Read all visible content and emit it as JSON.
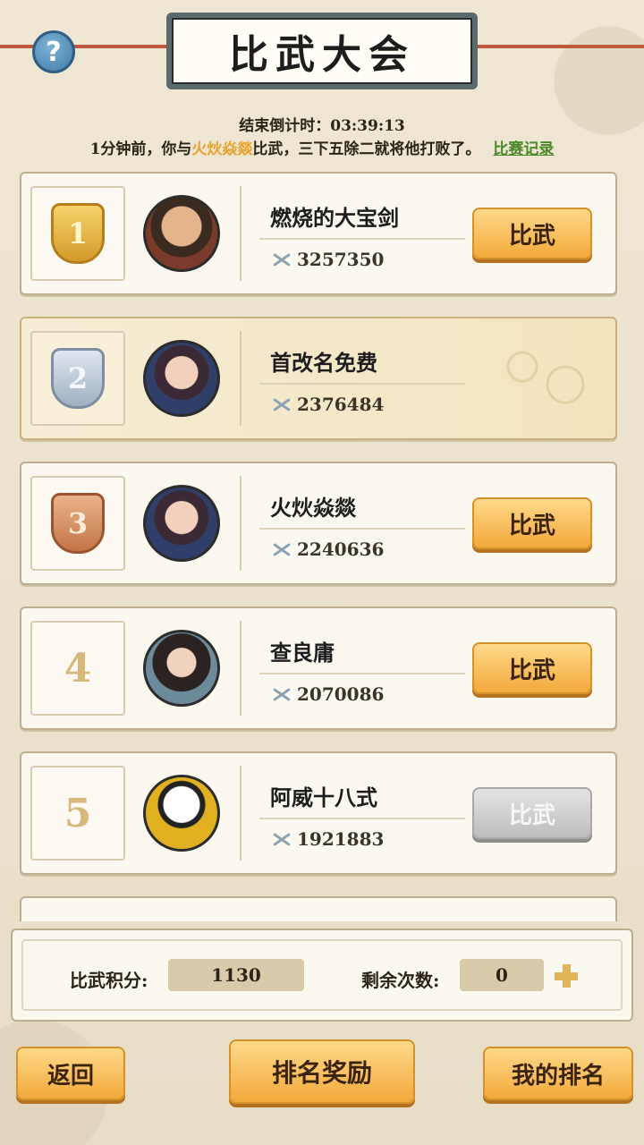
{
  "header": {
    "title": "比武大会",
    "help_glyph": "?"
  },
  "countdown": "结束倒计时：03:39:13",
  "notice": {
    "prefix": "1分钟前，你与",
    "opponent": "火炏焱燚",
    "suffix": "比武，三下五除二就将他打败了。",
    "record_link": "比赛记录"
  },
  "players": [
    {
      "rank": "1",
      "name": "燃烧的大宝剑",
      "power": "3257350",
      "action": "比武",
      "enabled": true
    },
    {
      "rank": "2",
      "name": "首改名免费",
      "power": "2376484",
      "action": "",
      "enabled": false
    },
    {
      "rank": "3",
      "name": "火炏焱燚",
      "power": "2240636",
      "action": "比武",
      "enabled": true
    },
    {
      "rank": "4",
      "name": "查良庸",
      "power": "2070086",
      "action": "比武",
      "enabled": true
    },
    {
      "rank": "5",
      "name": "阿威十八式",
      "power": "1921883",
      "action": "比武",
      "enabled": false
    }
  ],
  "stats": {
    "score_label": "比武积分:",
    "score_value": "1130",
    "remaining_label": "剩余次数:",
    "remaining_value": "0"
  },
  "buttons": {
    "back": "返回",
    "rank_reward": "排名奖励",
    "my_rank": "我的排名"
  },
  "colors": {
    "accent_orange": "#f2a93a",
    "opponent_highlight": "#e8a12c",
    "record_link": "#4a8a2a"
  }
}
